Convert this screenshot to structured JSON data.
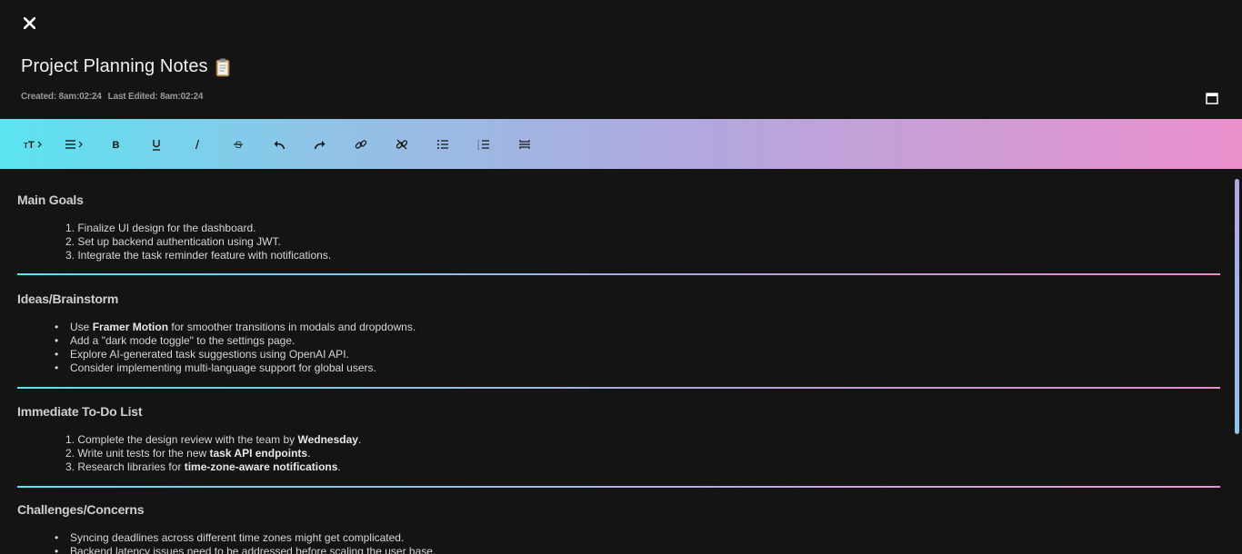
{
  "note": {
    "title": "Project Planning Notes",
    "created": "Created: 8am:02:24",
    "last_edited": "Last Edited: 8am:02:24"
  },
  "icons": {
    "close": "close-icon",
    "title_emoji": "clipboard-icon",
    "calendar": "calendar-icon"
  },
  "toolbar": [
    "font-size-icon",
    "align-icon",
    "bold-icon",
    "underline-icon",
    "italic-icon",
    "strikethrough-icon",
    "undo-icon",
    "redo-icon",
    "link-icon",
    "unlink-icon",
    "bullet-list-icon",
    "numbered-list-icon",
    "horizontal-rule-icon"
  ],
  "colors": {
    "background": "#141414",
    "gradient_start": "#5ae4f0",
    "gradient_mid": "#b0a8de",
    "gradient_end": "#ea8fcc"
  },
  "sections": {
    "main_goals": {
      "heading": "Main Goals",
      "items": [
        "Finalize UI design for the dashboard.",
        "Set up backend authentication using JWT.",
        "Integrate the task reminder feature with notifications."
      ]
    },
    "ideas": {
      "heading": "Ideas/Brainstorm",
      "item1_pre": "Use ",
      "item1_bold": "Framer Motion",
      "item1_post": " for smoother transitions in modals and dropdowns.",
      "item2": "Add a \"dark mode toggle\" to the settings page.",
      "item3": "Explore AI-generated task suggestions using OpenAI API.",
      "item4": "Consider implementing multi-language support for global users."
    },
    "todo": {
      "heading": "Immediate To-Do List",
      "item1_pre": "Complete the design review with the team by ",
      "item1_bold": "Wednesday",
      "item1_post": ".",
      "item2_pre": "Write unit tests for the new ",
      "item2_bold": "task API endpoints",
      "item2_post": ".",
      "item3_pre": "Research libraries for ",
      "item3_bold": "time-zone-aware notifications",
      "item3_post": "."
    },
    "challenges": {
      "heading": "Challenges/Concerns",
      "item1": "Syncing deadlines across different time zones might get complicated.",
      "item2": "Backend latency issues need to be addressed before scaling the user base."
    }
  }
}
